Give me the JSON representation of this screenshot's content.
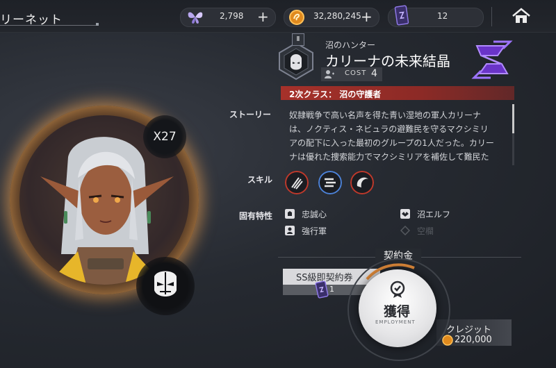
{
  "header": {
    "breadcrumb": "リーネット",
    "currencies": [
      {
        "icon": "butterfly-icon",
        "value": "2,798",
        "addable": true
      },
      {
        "icon": "coin-icon",
        "value": "32,280,245",
        "addable": true
      },
      {
        "icon": "card-ticket-icon",
        "value": "12",
        "addable": false
      }
    ],
    "home_icon": "home-icon"
  },
  "character": {
    "multiplier": "X27",
    "class_rank": "Ⅱ",
    "subtitle": "沼のハンター",
    "name": "カリーナの未来結晶",
    "cost_label": "COST",
    "cost_value": "4",
    "secondary_class": "2次クラス： 沼の守護者"
  },
  "story": {
    "label": "ストーリー",
    "lines": [
      "奴隷戦争で高い名声を得た青い湿地の軍人カリーナ",
      "は、ノクティス・ネビュラの避難民を守るマクシミリ",
      "アの配下に入った最初のグループの1人だった。カリー",
      "ナは優れた捜索能力でマクシミリアを補佐して難民た"
    ]
  },
  "skills": {
    "label": "スキル",
    "items": [
      "claw-skill-icon",
      "speed-skill-icon",
      "shield-skill-icon"
    ]
  },
  "traits": {
    "label": "固有特性",
    "items": [
      {
        "icon": "loyalty-icon",
        "label": "忠誠心",
        "active": true
      },
      {
        "icon": "swamp-elf-icon",
        "label": "沼エルフ",
        "active": true
      },
      {
        "icon": "march-icon",
        "label": "強行軍",
        "active": true
      },
      {
        "icon": "empty-slot-icon",
        "label": "空欄",
        "active": false
      }
    ]
  },
  "contract": {
    "title": "契約金",
    "ticket_label": "SS級即契約券",
    "ticket_count": "1",
    "acquire_label": "獲得",
    "acquire_sub": "EMPLOYMENT",
    "credit_label": "クレジット",
    "credit_value": "220,000"
  },
  "colors": {
    "accent_red": "#a6312a",
    "gold": "#f0b060",
    "faction_purple": "#7b3fe0"
  }
}
